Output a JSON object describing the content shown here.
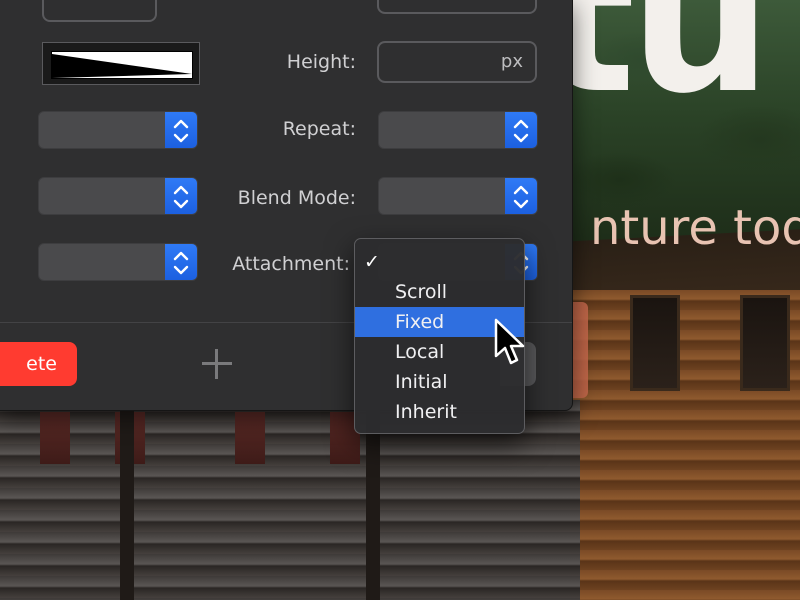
{
  "background": {
    "headline": "tu",
    "tagline": "nture toda"
  },
  "panel": {
    "rows": [
      {
        "label": "Height:",
        "unit": "px"
      },
      {
        "label": "Repeat:"
      },
      {
        "label": "Blend Mode:"
      },
      {
        "label": "Attachment:"
      }
    ],
    "delete_label": "ete"
  },
  "menu": {
    "items": [
      "",
      "Scroll",
      "Fixed",
      "Local",
      "Initial",
      "Inherit"
    ],
    "checked_index": 0,
    "highlighted_index": 2,
    "check_glyph": "✓"
  },
  "colors": {
    "accent": "#2f6fe0",
    "danger": "#ff3b30",
    "panel_bg": "#2f2f30"
  }
}
